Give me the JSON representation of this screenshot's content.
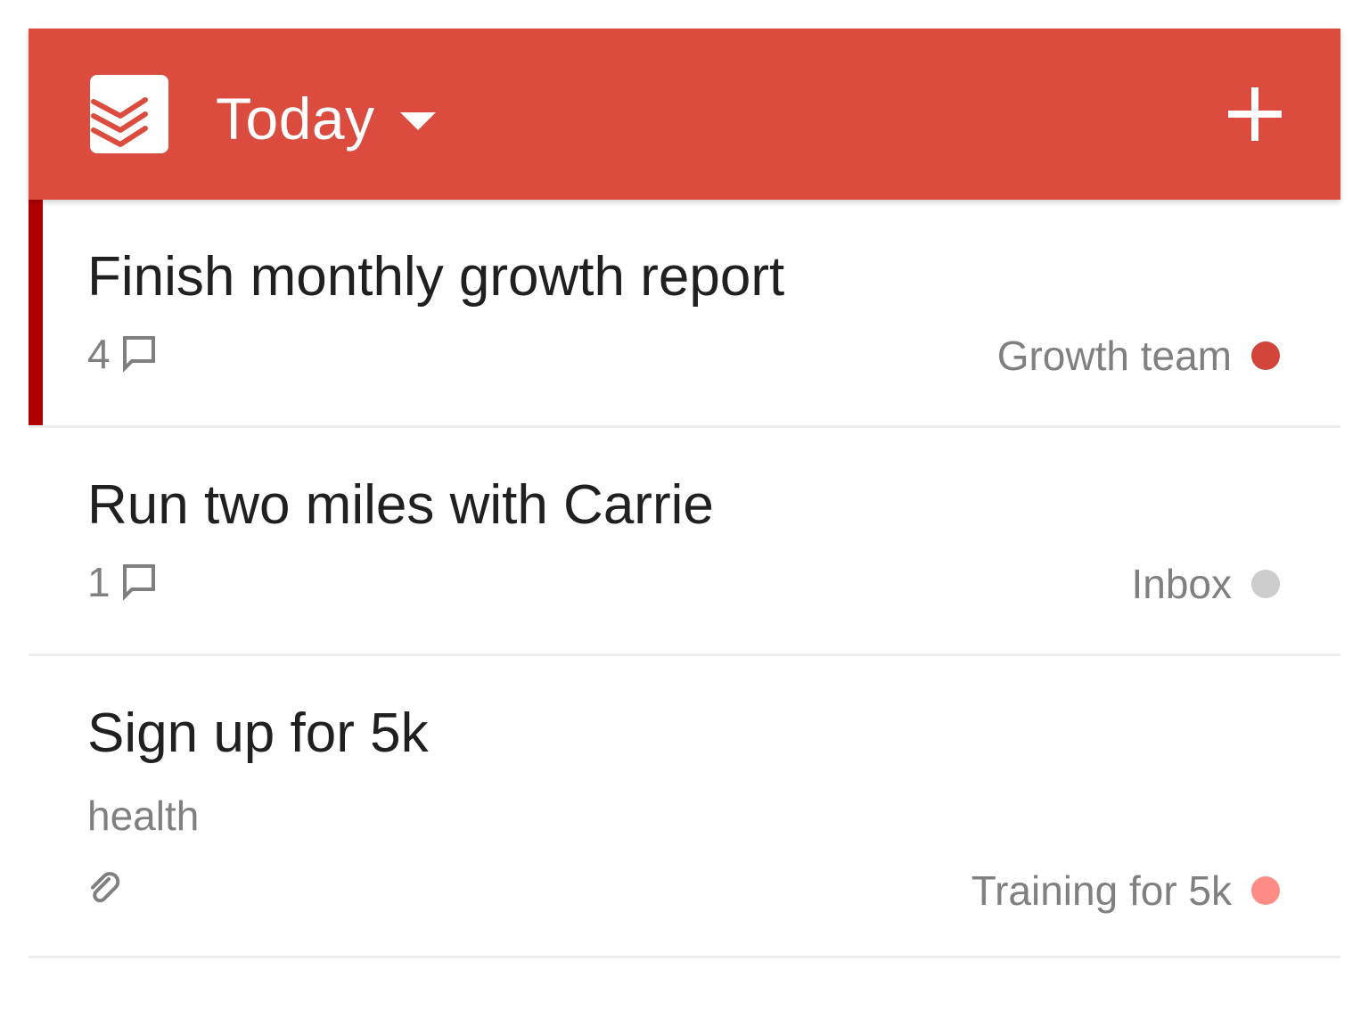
{
  "header": {
    "title": "Today",
    "background_color": "#db4c3f",
    "logo_icon": "todoist-logo-icon",
    "dropdown_icon": "caret-down-icon",
    "add_icon": "plus-icon"
  },
  "tasks": [
    {
      "title": "Finish monthly growth report",
      "comment_count": "4",
      "comment_icon": "comment-icon",
      "project": "Growth team",
      "project_color": "#d1453b",
      "priority_color": "#b00000"
    },
    {
      "title": "Run two miles with Carrie",
      "comment_count": "1",
      "comment_icon": "comment-icon",
      "project": "Inbox",
      "project_color": "#cccccc"
    },
    {
      "title": "Sign up for 5k",
      "label": "health",
      "attachment_icon": "paperclip-icon",
      "project": "Training for 5k",
      "project_color": "#ff8d85"
    }
  ]
}
